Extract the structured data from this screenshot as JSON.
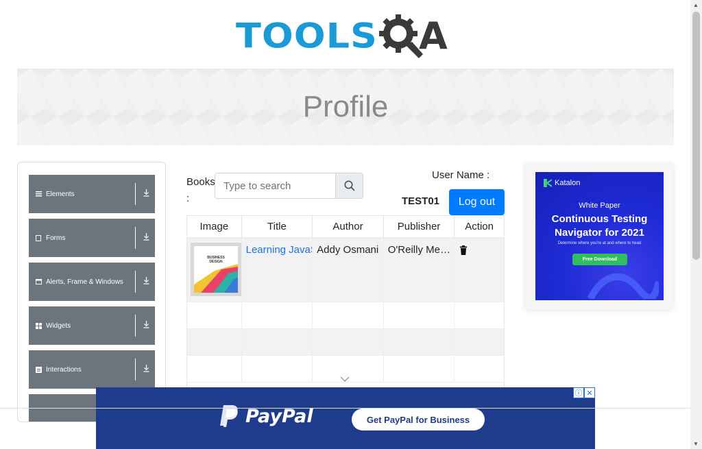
{
  "logo": {
    "part1": "TOOLS",
    "part2": "A"
  },
  "banner": {
    "title": "Profile"
  },
  "sidebar": {
    "groups": [
      {
        "label": "Elements",
        "icon": "hamburger-icon"
      },
      {
        "label": "Forms",
        "icon": "form-icon"
      },
      {
        "label": "Alerts, Frame & Windows",
        "icon": "window-icon"
      },
      {
        "label": "Widgets",
        "icon": "widgets-icon"
      },
      {
        "label": "Interactions",
        "icon": "interactions-icon"
      }
    ]
  },
  "main": {
    "books_label": "Books :",
    "search_placeholder": "Type to search",
    "user_name_label": "User Name :",
    "user_name_value": "TEST01",
    "logout_label": "Log out"
  },
  "table": {
    "headers": [
      "Image",
      "Title",
      "Author",
      "Publisher",
      "Action"
    ],
    "rows": [
      {
        "title": "Learning JavaScript Design Patterns",
        "author": "Addy Osmani",
        "publisher": "O'Reilly Media",
        "thumb_lines": [
          "BUSINESS",
          "DESIGN"
        ]
      }
    ]
  },
  "side_ad": {
    "brand": "Katalon",
    "kicker": "White Paper",
    "title_line1": "Continuous Testing",
    "title_line2": "Navigator for 2021",
    "subtitle": "Determine where you're at and where to head",
    "cta": "Free Download"
  },
  "bottom_ad": {
    "brand": "PayPal",
    "cta": "Get PayPal for Business"
  },
  "colors": {
    "accent": "#007bff",
    "sidebar_group": "#6c757d",
    "link": "#1a73e8",
    "paypal_bg": "#1f3b8c"
  }
}
